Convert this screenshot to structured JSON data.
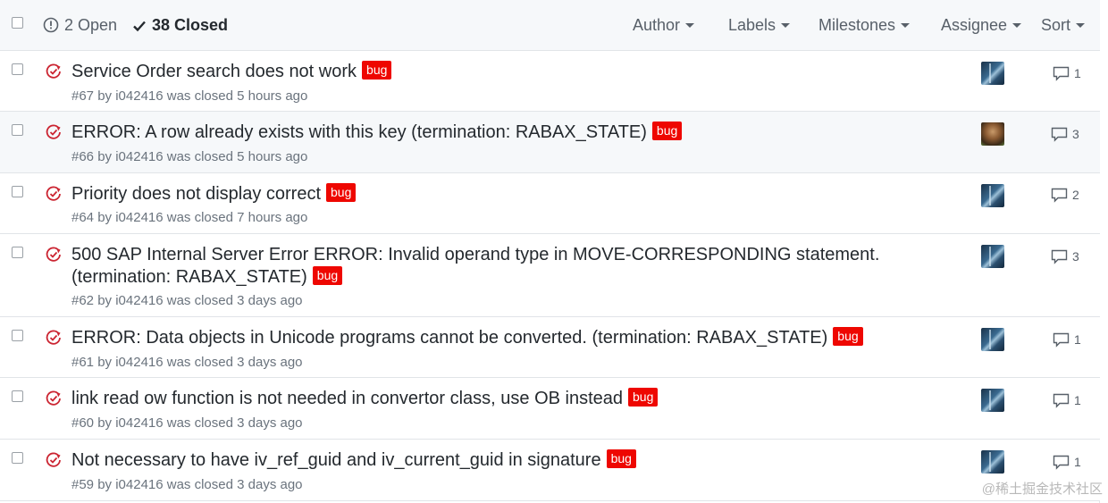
{
  "header": {
    "open_count_label": "2 Open",
    "closed_count_label": "38 Closed",
    "filters": [
      "Author",
      "Labels",
      "Milestones",
      "Assignee",
      "Sort"
    ]
  },
  "issues": [
    {
      "title": "Service Order search does not work",
      "label": "bug",
      "meta": "#67 by i042416 was closed 5 hours ago",
      "comments": "1",
      "avatar": "blue-abstract"
    },
    {
      "title": "ERROR: A row already exists with this key (termination: RABAX_STATE)",
      "label": "bug",
      "meta": "#66 by i042416 was closed 5 hours ago",
      "comments": "3",
      "avatar": "person-photo"
    },
    {
      "title": "Priority does not display correct",
      "label": "bug",
      "meta": "#64 by i042416 was closed 7 hours ago",
      "comments": "2",
      "avatar": "blue-abstract"
    },
    {
      "title": "500 SAP Internal Server Error ERROR: Invalid operand type in MOVE-CORRESPONDING statement. (termination: RABAX_STATE)",
      "label": "bug",
      "meta": "#62 by i042416 was closed 3 days ago",
      "comments": "3",
      "avatar": "blue-abstract"
    },
    {
      "title": "ERROR: Data objects in Unicode programs cannot be converted. (termination: RABAX_STATE)",
      "label": "bug",
      "meta": "#61 by i042416 was closed 3 days ago",
      "comments": "1",
      "avatar": "blue-abstract"
    },
    {
      "title": "link read ow function is not needed in convertor class, use OB instead",
      "label": "bug",
      "meta": "#60 by i042416 was closed 3 days ago",
      "comments": "1",
      "avatar": "blue-abstract"
    },
    {
      "title": "Not necessary to have iv_ref_guid and iv_current_guid in signature",
      "label": "bug",
      "meta": "#59 by i042416 was closed 3 days ago",
      "comments": "1",
      "avatar": "blue-abstract"
    }
  ],
  "icons": {
    "open_state": "issue-opened-icon",
    "closed_state": "check-icon",
    "row_state": "issue-closed-icon",
    "comments": "comment-icon"
  },
  "colors": {
    "label_bug": "#ee0701",
    "closed_icon": "#cb2431",
    "header_bg": "#f6f8fa"
  },
  "watermark": "@稀土掘金技术社区"
}
